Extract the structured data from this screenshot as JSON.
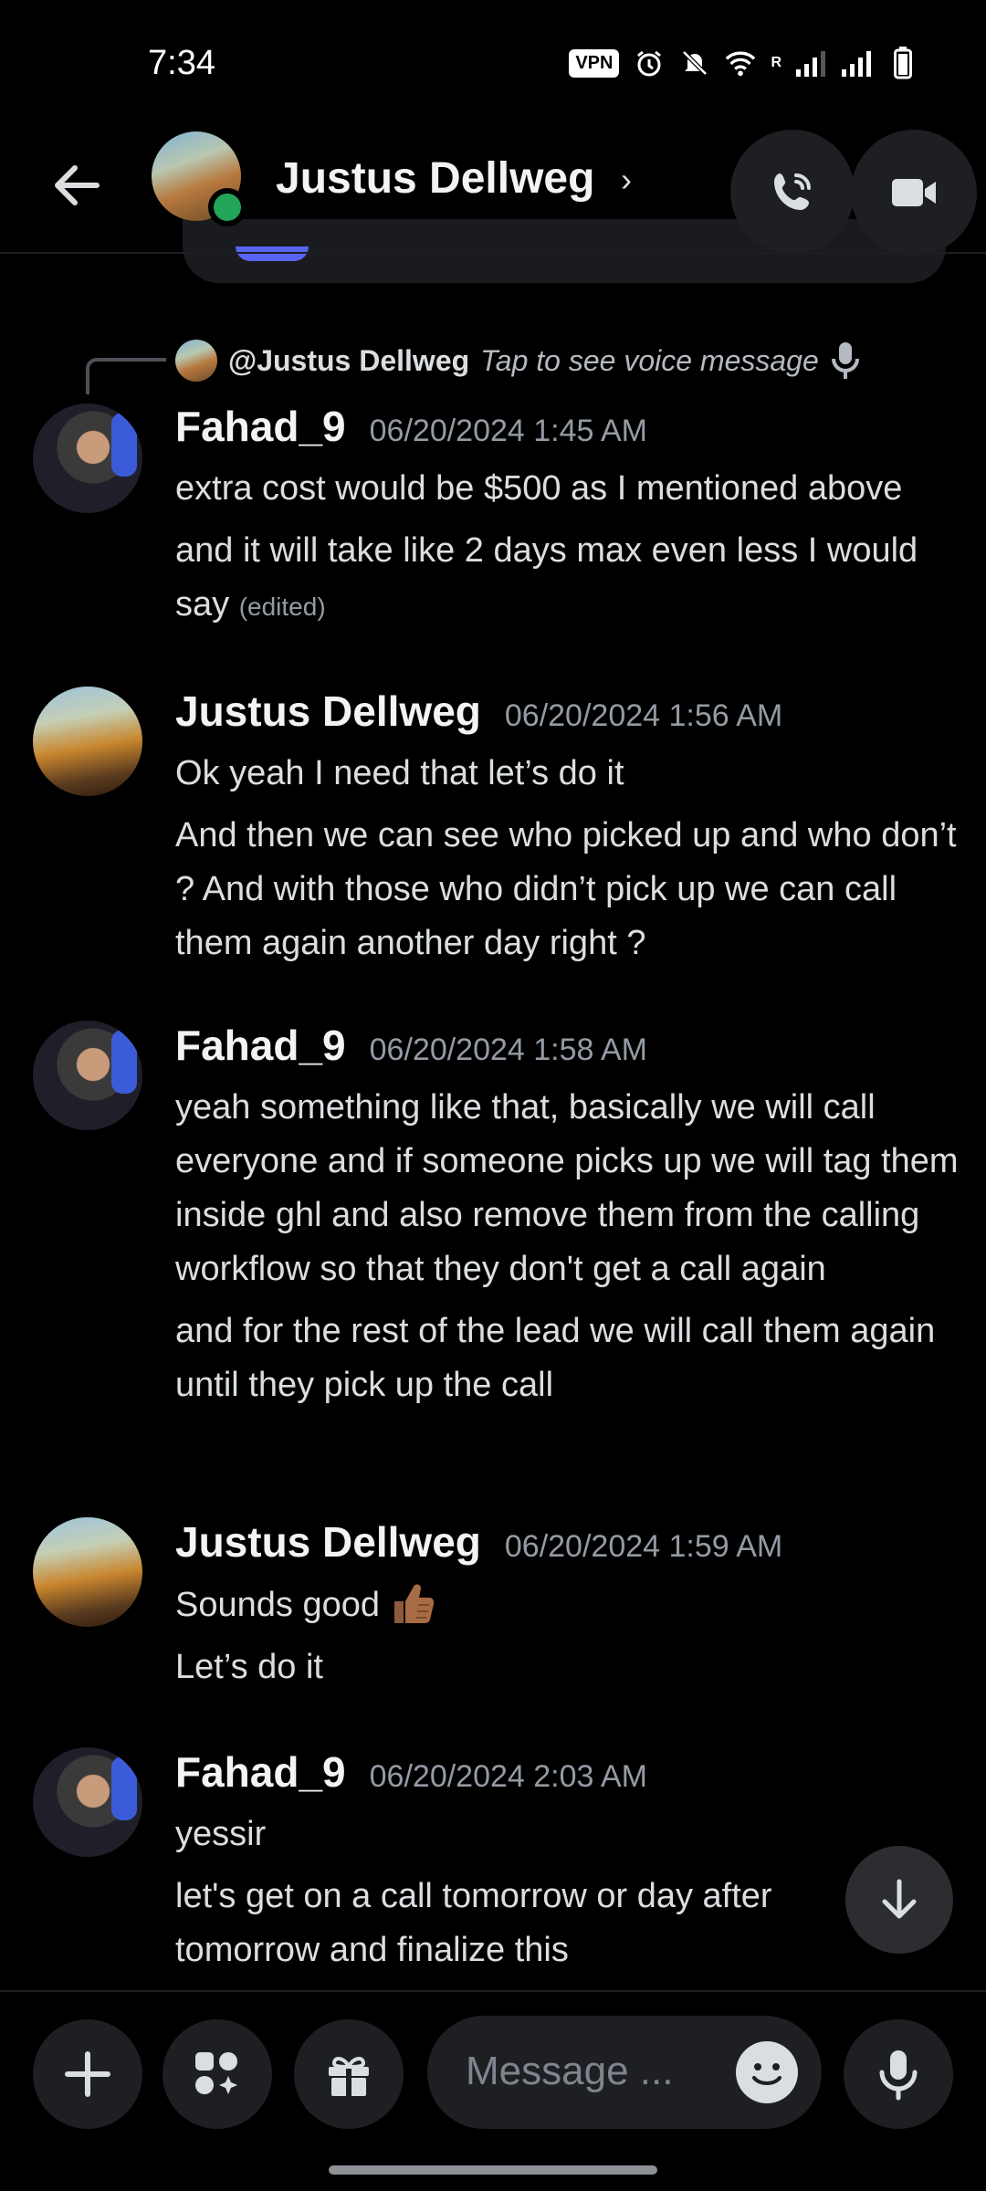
{
  "status_bar": {
    "time": "7:34",
    "vpn": "VPN",
    "network_badge": "R"
  },
  "header": {
    "contact_name": "Justus Dellweg",
    "chevron": "›"
  },
  "reply": {
    "user": "@Justus Dellweg",
    "text": "Tap to see voice message"
  },
  "messages": [
    {
      "user": "Fahad_9",
      "time": "06/20/2024 1:45 AM",
      "lines": [
        "extra cost would be $500 as I mentioned above",
        "and it will take like 2 days max even less I would say"
      ],
      "edited": "(edited)"
    },
    {
      "user": "Justus Dellweg",
      "time": "06/20/2024 1:56 AM",
      "lines": [
        "Ok yeah I need that let’s do it",
        "And then we can see who picked up and who don’t ? And with those who didn’t pick up we can call them again another day right ?"
      ]
    },
    {
      "user": "Fahad_9",
      "time": "06/20/2024 1:58 AM",
      "lines": [
        "yeah something like that, basically we will call everyone and if someone picks up we will tag them inside ghl and also remove them from the calling workflow so that they don't get a call again",
        "and for the rest of the lead we will call them again until they pick up the call"
      ]
    },
    {
      "user": "Justus Dellweg",
      "time": "06/20/2024 1:59 AM",
      "lines": [
        "Sounds good",
        "Let’s do it"
      ]
    },
    {
      "user": "Fahad_9",
      "time": "06/20/2024 2:03 AM",
      "lines": [
        "yessir",
        "let's get on a call tomorrow or day after tomorrow and finalize this"
      ]
    }
  ],
  "composer": {
    "placeholder": "Message ..."
  },
  "colors": {
    "background": "#000000",
    "online": "#23a55a",
    "surface": "#1e1f22",
    "accent": "#5865f2"
  },
  "icons": [
    "back-arrow-icon",
    "phone-call-icon",
    "video-camera-icon",
    "microphone-icon",
    "plus-icon",
    "apps-icon",
    "gift-icon",
    "emoji-icon",
    "arrow-down-icon",
    "thumbs-up-emoji"
  ]
}
